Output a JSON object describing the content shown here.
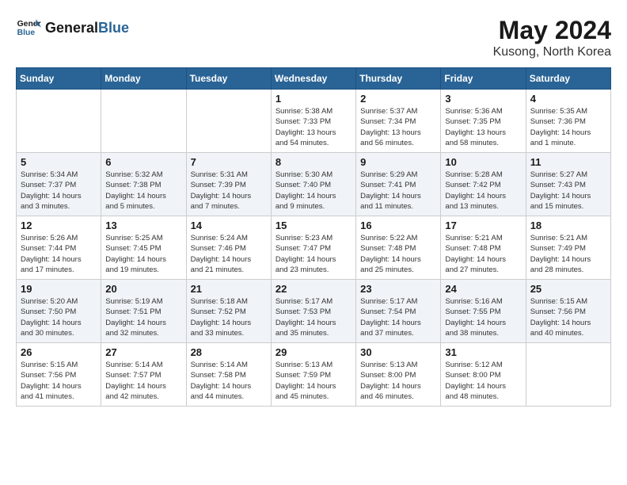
{
  "header": {
    "logo_general": "General",
    "logo_blue": "Blue",
    "month_title": "May 2024",
    "location": "Kusong, North Korea"
  },
  "weekdays": [
    "Sunday",
    "Monday",
    "Tuesday",
    "Wednesday",
    "Thursday",
    "Friday",
    "Saturday"
  ],
  "weeks": [
    [
      {
        "day": "",
        "info": ""
      },
      {
        "day": "",
        "info": ""
      },
      {
        "day": "",
        "info": ""
      },
      {
        "day": "1",
        "info": "Sunrise: 5:38 AM\nSunset: 7:33 PM\nDaylight: 13 hours\nand 54 minutes."
      },
      {
        "day": "2",
        "info": "Sunrise: 5:37 AM\nSunset: 7:34 PM\nDaylight: 13 hours\nand 56 minutes."
      },
      {
        "day": "3",
        "info": "Sunrise: 5:36 AM\nSunset: 7:35 PM\nDaylight: 13 hours\nand 58 minutes."
      },
      {
        "day": "4",
        "info": "Sunrise: 5:35 AM\nSunset: 7:36 PM\nDaylight: 14 hours\nand 1 minute."
      }
    ],
    [
      {
        "day": "5",
        "info": "Sunrise: 5:34 AM\nSunset: 7:37 PM\nDaylight: 14 hours\nand 3 minutes."
      },
      {
        "day": "6",
        "info": "Sunrise: 5:32 AM\nSunset: 7:38 PM\nDaylight: 14 hours\nand 5 minutes."
      },
      {
        "day": "7",
        "info": "Sunrise: 5:31 AM\nSunset: 7:39 PM\nDaylight: 14 hours\nand 7 minutes."
      },
      {
        "day": "8",
        "info": "Sunrise: 5:30 AM\nSunset: 7:40 PM\nDaylight: 14 hours\nand 9 minutes."
      },
      {
        "day": "9",
        "info": "Sunrise: 5:29 AM\nSunset: 7:41 PM\nDaylight: 14 hours\nand 11 minutes."
      },
      {
        "day": "10",
        "info": "Sunrise: 5:28 AM\nSunset: 7:42 PM\nDaylight: 14 hours\nand 13 minutes."
      },
      {
        "day": "11",
        "info": "Sunrise: 5:27 AM\nSunset: 7:43 PM\nDaylight: 14 hours\nand 15 minutes."
      }
    ],
    [
      {
        "day": "12",
        "info": "Sunrise: 5:26 AM\nSunset: 7:44 PM\nDaylight: 14 hours\nand 17 minutes."
      },
      {
        "day": "13",
        "info": "Sunrise: 5:25 AM\nSunset: 7:45 PM\nDaylight: 14 hours\nand 19 minutes."
      },
      {
        "day": "14",
        "info": "Sunrise: 5:24 AM\nSunset: 7:46 PM\nDaylight: 14 hours\nand 21 minutes."
      },
      {
        "day": "15",
        "info": "Sunrise: 5:23 AM\nSunset: 7:47 PM\nDaylight: 14 hours\nand 23 minutes."
      },
      {
        "day": "16",
        "info": "Sunrise: 5:22 AM\nSunset: 7:48 PM\nDaylight: 14 hours\nand 25 minutes."
      },
      {
        "day": "17",
        "info": "Sunrise: 5:21 AM\nSunset: 7:48 PM\nDaylight: 14 hours\nand 27 minutes."
      },
      {
        "day": "18",
        "info": "Sunrise: 5:21 AM\nSunset: 7:49 PM\nDaylight: 14 hours\nand 28 minutes."
      }
    ],
    [
      {
        "day": "19",
        "info": "Sunrise: 5:20 AM\nSunset: 7:50 PM\nDaylight: 14 hours\nand 30 minutes."
      },
      {
        "day": "20",
        "info": "Sunrise: 5:19 AM\nSunset: 7:51 PM\nDaylight: 14 hours\nand 32 minutes."
      },
      {
        "day": "21",
        "info": "Sunrise: 5:18 AM\nSunset: 7:52 PM\nDaylight: 14 hours\nand 33 minutes."
      },
      {
        "day": "22",
        "info": "Sunrise: 5:17 AM\nSunset: 7:53 PM\nDaylight: 14 hours\nand 35 minutes."
      },
      {
        "day": "23",
        "info": "Sunrise: 5:17 AM\nSunset: 7:54 PM\nDaylight: 14 hours\nand 37 minutes."
      },
      {
        "day": "24",
        "info": "Sunrise: 5:16 AM\nSunset: 7:55 PM\nDaylight: 14 hours\nand 38 minutes."
      },
      {
        "day": "25",
        "info": "Sunrise: 5:15 AM\nSunset: 7:56 PM\nDaylight: 14 hours\nand 40 minutes."
      }
    ],
    [
      {
        "day": "26",
        "info": "Sunrise: 5:15 AM\nSunset: 7:56 PM\nDaylight: 14 hours\nand 41 minutes."
      },
      {
        "day": "27",
        "info": "Sunrise: 5:14 AM\nSunset: 7:57 PM\nDaylight: 14 hours\nand 42 minutes."
      },
      {
        "day": "28",
        "info": "Sunrise: 5:14 AM\nSunset: 7:58 PM\nDaylight: 14 hours\nand 44 minutes."
      },
      {
        "day": "29",
        "info": "Sunrise: 5:13 AM\nSunset: 7:59 PM\nDaylight: 14 hours\nand 45 minutes."
      },
      {
        "day": "30",
        "info": "Sunrise: 5:13 AM\nSunset: 8:00 PM\nDaylight: 14 hours\nand 46 minutes."
      },
      {
        "day": "31",
        "info": "Sunrise: 5:12 AM\nSunset: 8:00 PM\nDaylight: 14 hours\nand 48 minutes."
      },
      {
        "day": "",
        "info": ""
      }
    ]
  ]
}
